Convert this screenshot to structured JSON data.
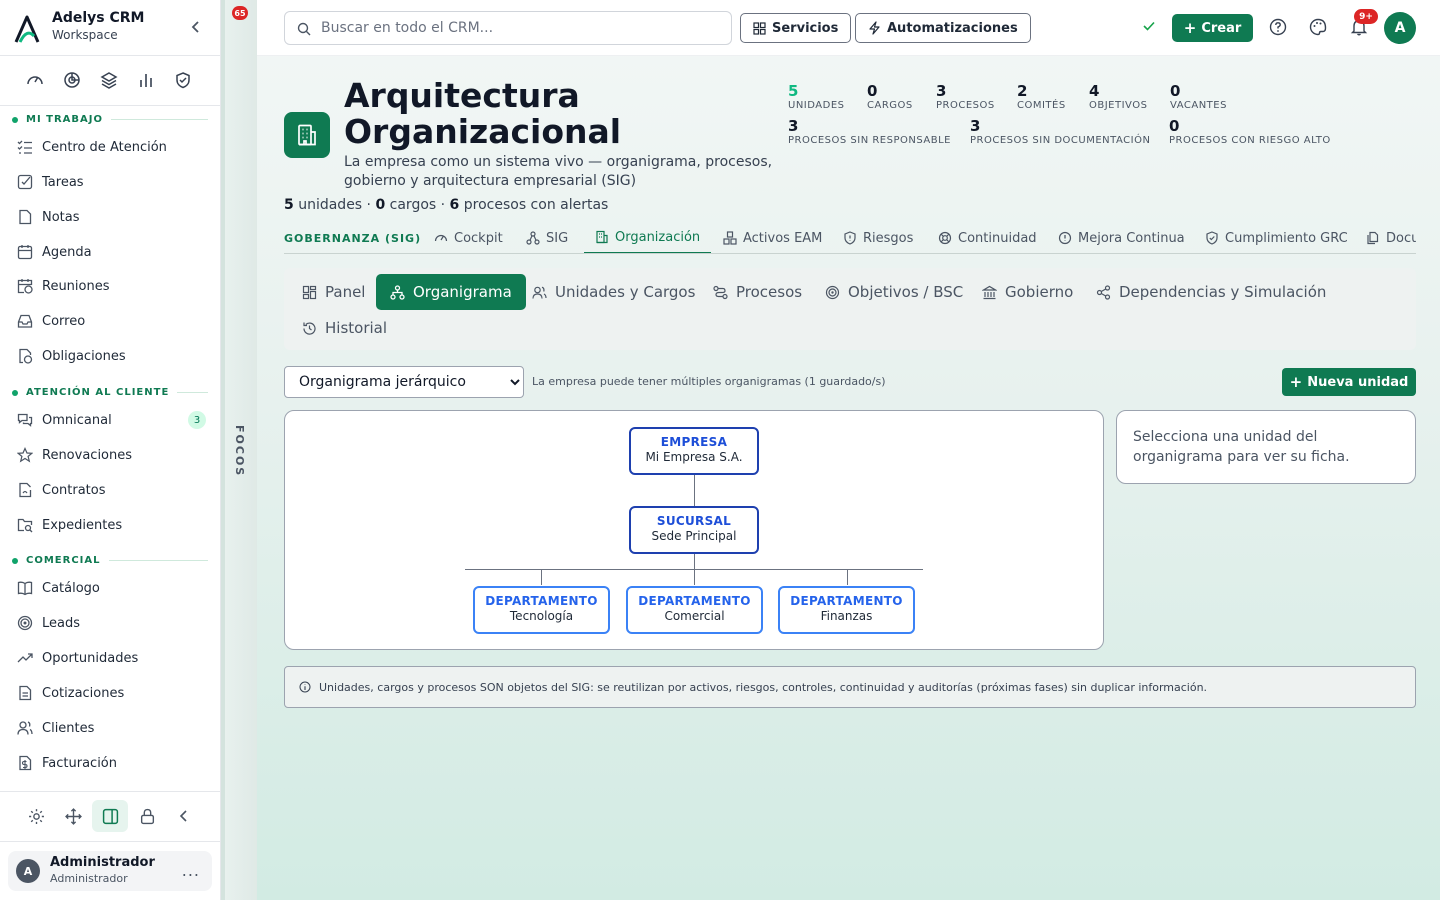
{
  "app": {
    "name": "Adelys CRM",
    "workspace": "Workspace"
  },
  "sidebar": {
    "quick_icons": [
      "gauge-icon",
      "target-chart-icon",
      "layers-icon",
      "bar-chart-icon",
      "shield-check-icon"
    ],
    "sections": [
      {
        "title": "MI TRABAJO",
        "items": [
          {
            "label": "Centro de Atención",
            "icon": "list-check-icon"
          },
          {
            "label": "Tareas",
            "icon": "checkbox-icon"
          },
          {
            "label": "Notas",
            "icon": "note-icon"
          },
          {
            "label": "Agenda",
            "icon": "calendar-icon"
          },
          {
            "label": "Reuniones",
            "icon": "calendar-clock-icon"
          },
          {
            "label": "Correo",
            "icon": "inbox-icon"
          },
          {
            "label": "Obligaciones",
            "icon": "file-clock-icon"
          }
        ]
      },
      {
        "title": "ATENCIÓN AL CLIENTE",
        "items": [
          {
            "label": "Omnicanal",
            "icon": "chat-icon",
            "badge": "3"
          },
          {
            "label": "Renovaciones",
            "icon": "star-icon"
          },
          {
            "label": "Contratos",
            "icon": "file-signature-icon"
          },
          {
            "label": "Expedientes",
            "icon": "folder-search-icon"
          }
        ]
      },
      {
        "title": "COMERCIAL",
        "items": [
          {
            "label": "Catálogo",
            "icon": "book-icon"
          },
          {
            "label": "Leads",
            "icon": "target-icon"
          },
          {
            "label": "Oportunidades",
            "icon": "trending-up-icon"
          },
          {
            "label": "Cotizaciones",
            "icon": "document-icon"
          },
          {
            "label": "Clientes",
            "icon": "users-icon"
          },
          {
            "label": "Facturación",
            "icon": "invoice-icon"
          }
        ]
      }
    ],
    "user": {
      "initial": "A",
      "name": "Administrador",
      "role": "Administrador",
      "more": "..."
    }
  },
  "focos": {
    "count": "65",
    "label": "FOCOS"
  },
  "topbar": {
    "search_placeholder": "Buscar en todo el CRM...",
    "servicios": "Servicios",
    "automatizaciones": "Automatizaciones",
    "crear": "Crear",
    "notif_badge": "9+",
    "avatar": "A"
  },
  "page": {
    "title": "Arquitectura Organizacional",
    "description": "La empresa como un sistema vivo — organigrama, procesos, gobierno y arquitectura empresarial (SIG)",
    "summary": {
      "u": "5",
      "u_label": " unidades · ",
      "c": "0",
      "c_label": " cargos · ",
      "p": "6",
      "p_label": " procesos con alertas"
    },
    "kpis": [
      {
        "value": "5",
        "label": "UNIDADES"
      },
      {
        "value": "0",
        "label": "CARGOS"
      },
      {
        "value": "3",
        "label": "PROCESOS"
      },
      {
        "value": "2",
        "label": "COMITÉS"
      },
      {
        "value": "4",
        "label": "OBJETIVOS"
      },
      {
        "value": "0",
        "label": "VACANTES"
      },
      {
        "value": "3",
        "label": "PROCESOS SIN RESPONSABLE"
      },
      {
        "value": "3",
        "label": "PROCESOS SIN DOCUMENTACIÓN"
      },
      {
        "value": "0",
        "label": "PROCESOS CON RIESGO ALTO"
      }
    ]
  },
  "module_tabs": {
    "section": "GOBERNANZA (SIG)",
    "tabs": [
      "Cockpit",
      "SIG",
      "Organización",
      "Activos EAM",
      "Riesgos",
      "Continuidad",
      "Mejora Continua",
      "Cumplimiento GRC",
      "Docu"
    ],
    "active": "Organización"
  },
  "sub_tabs": {
    "tabs": [
      "Panel",
      "Organigrama",
      "Unidades y Cargos",
      "Procesos",
      "Objetivos / BSC",
      "Gobierno",
      "Dependencias y Simulación",
      "Historial"
    ],
    "active": "Organigrama"
  },
  "controls": {
    "select_value": "Organigrama jerárquico",
    "hint": "La empresa puede tener múltiples organigramas (1 guardado/s)",
    "nueva_unidad": "Nueva unidad"
  },
  "orgchart": {
    "root": {
      "type": "EMPRESA",
      "name": "Mi Empresa S.A."
    },
    "branch": {
      "type": "SUCURSAL",
      "name": "Sede Principal"
    },
    "departments": [
      {
        "type": "DEPARTAMENTO",
        "name": "Tecnología"
      },
      {
        "type": "DEPARTAMENTO",
        "name": "Comercial"
      },
      {
        "type": "DEPARTAMENTO",
        "name": "Finanzas"
      }
    ]
  },
  "detail_placeholder": "Selecciona una unidad del organigrama para ver su ficha.",
  "info_note": "Unidades, cargos y procesos SON objetos del SIG: se reutilizan por activos, riesgos, controles, continuidad y auditorías (próximas fases) sin duplicar información."
}
